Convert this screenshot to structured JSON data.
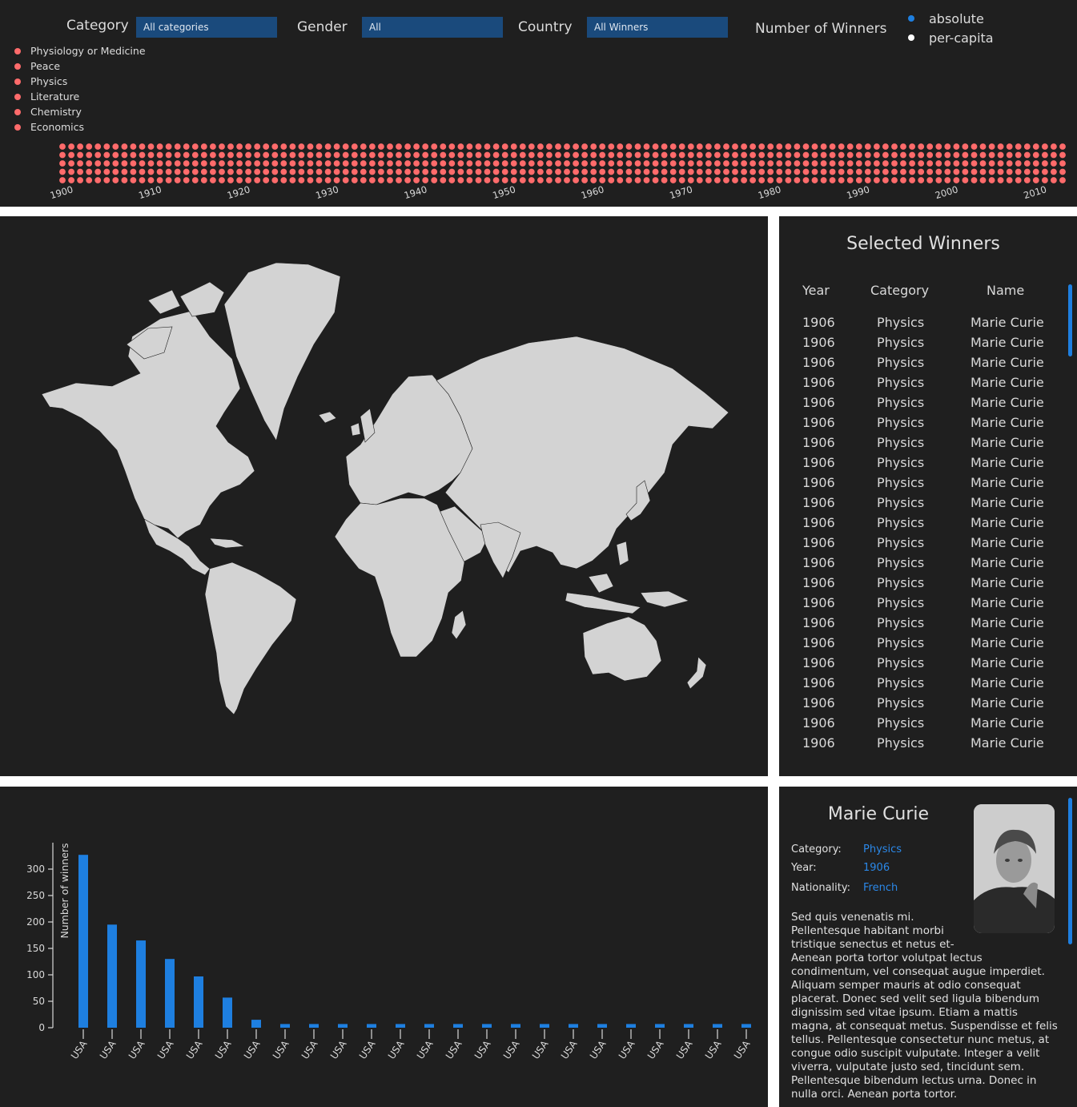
{
  "controls": {
    "category_label": "Category",
    "category_value": "All categories",
    "gender_label": "Gender",
    "gender_value": "All",
    "country_label": "Country",
    "country_value": "All Winners",
    "metric_label": "Number of Winners",
    "metric_options": [
      {
        "label": "absolute",
        "selected": true,
        "color": "#1e7fe0"
      },
      {
        "label": "per-capita",
        "selected": false,
        "color": "#ffffff"
      }
    ]
  },
  "legend": {
    "items": [
      "Physiology or Medicine",
      "Peace",
      "Physics",
      "Literature",
      "Chemistry",
      "Economics"
    ],
    "dot_color": "#ff6b6b"
  },
  "timeline": {
    "ticks": [
      "1900",
      "1910",
      "1920",
      "1930",
      "1940",
      "1950",
      "1960",
      "1970",
      "1980",
      "1990",
      "2000",
      "2010"
    ],
    "first_year": 1901,
    "last_year": 2014,
    "dots_per_year": 5,
    "dot_color": "#ff6b6b"
  },
  "map": {
    "land_color": "#d3d3d3",
    "background": "#1f1f1f"
  },
  "winners": {
    "title": "Selected Winners",
    "headers": [
      "Year",
      "Category",
      "Name"
    ],
    "rows": [
      [
        "1906",
        "Physics",
        "Marie Curie"
      ],
      [
        "1906",
        "Physics",
        "Marie Curie"
      ],
      [
        "1906",
        "Physics",
        "Marie Curie"
      ],
      [
        "1906",
        "Physics",
        "Marie Curie"
      ],
      [
        "1906",
        "Physics",
        "Marie Curie"
      ],
      [
        "1906",
        "Physics",
        "Marie Curie"
      ],
      [
        "1906",
        "Physics",
        "Marie Curie"
      ],
      [
        "1906",
        "Physics",
        "Marie Curie"
      ],
      [
        "1906",
        "Physics",
        "Marie Curie"
      ],
      [
        "1906",
        "Physics",
        "Marie Curie"
      ],
      [
        "1906",
        "Physics",
        "Marie Curie"
      ],
      [
        "1906",
        "Physics",
        "Marie Curie"
      ],
      [
        "1906",
        "Physics",
        "Marie Curie"
      ],
      [
        "1906",
        "Physics",
        "Marie Curie"
      ],
      [
        "1906",
        "Physics",
        "Marie Curie"
      ],
      [
        "1906",
        "Physics",
        "Marie Curie"
      ],
      [
        "1906",
        "Physics",
        "Marie Curie"
      ],
      [
        "1906",
        "Physics",
        "Marie Curie"
      ],
      [
        "1906",
        "Physics",
        "Marie Curie"
      ],
      [
        "1906",
        "Physics",
        "Marie Curie"
      ],
      [
        "1906",
        "Physics",
        "Marie Curie"
      ],
      [
        "1906",
        "Physics",
        "Marie Curie"
      ]
    ],
    "accent": "#1e7fe0"
  },
  "chart_data": {
    "type": "bar",
    "ylabel": "Number of winners",
    "ylim": [
      0,
      350
    ],
    "yticks": [
      0,
      50,
      100,
      150,
      200,
      250,
      300
    ],
    "categories": [
      "USA",
      "USA",
      "USA",
      "USA",
      "USA",
      "USA",
      "USA",
      "USA",
      "USA",
      "USA",
      "USA",
      "USA",
      "USA",
      "USA",
      "USA",
      "USA",
      "USA",
      "USA",
      "USA",
      "USA",
      "USA",
      "USA",
      "USA",
      "USA"
    ],
    "values": [
      327,
      195,
      165,
      130,
      97,
      57,
      15,
      7,
      7,
      7,
      7,
      7,
      7,
      7,
      7,
      7,
      7,
      7,
      7,
      7,
      7,
      7,
      7,
      7
    ],
    "bar_color": "#1e7fe0"
  },
  "detail": {
    "name": "Marie Curie",
    "fields": [
      {
        "label": "Category:",
        "value": "Physics"
      },
      {
        "label": "Year:",
        "value": "1906"
      },
      {
        "label": "Nationality:",
        "value": "French"
      }
    ],
    "bio": "Sed quis venenatis mi.\nPellentesque habitant morbi\ntristique senectus et netus et-\nAenean porta tortor volutpat lectus condimentum, vel consequat augue imperdiet. Aliquam semper mauris at odio consequat placerat. Donec sed velit sed ligula bibendum dignissim sed vitae ipsum. Etiam a mattis magna, at consequat metus. Suspendisse et felis tellus. Pellentesque consectetur nunc metus, at congue odio suscipit vulputate. Integer a velit viverra, vulputate justo sed, tincidunt sem. Pellentesque bibendum lectus urna. Donec in nulla orci. Aenean porta tortor."
  }
}
